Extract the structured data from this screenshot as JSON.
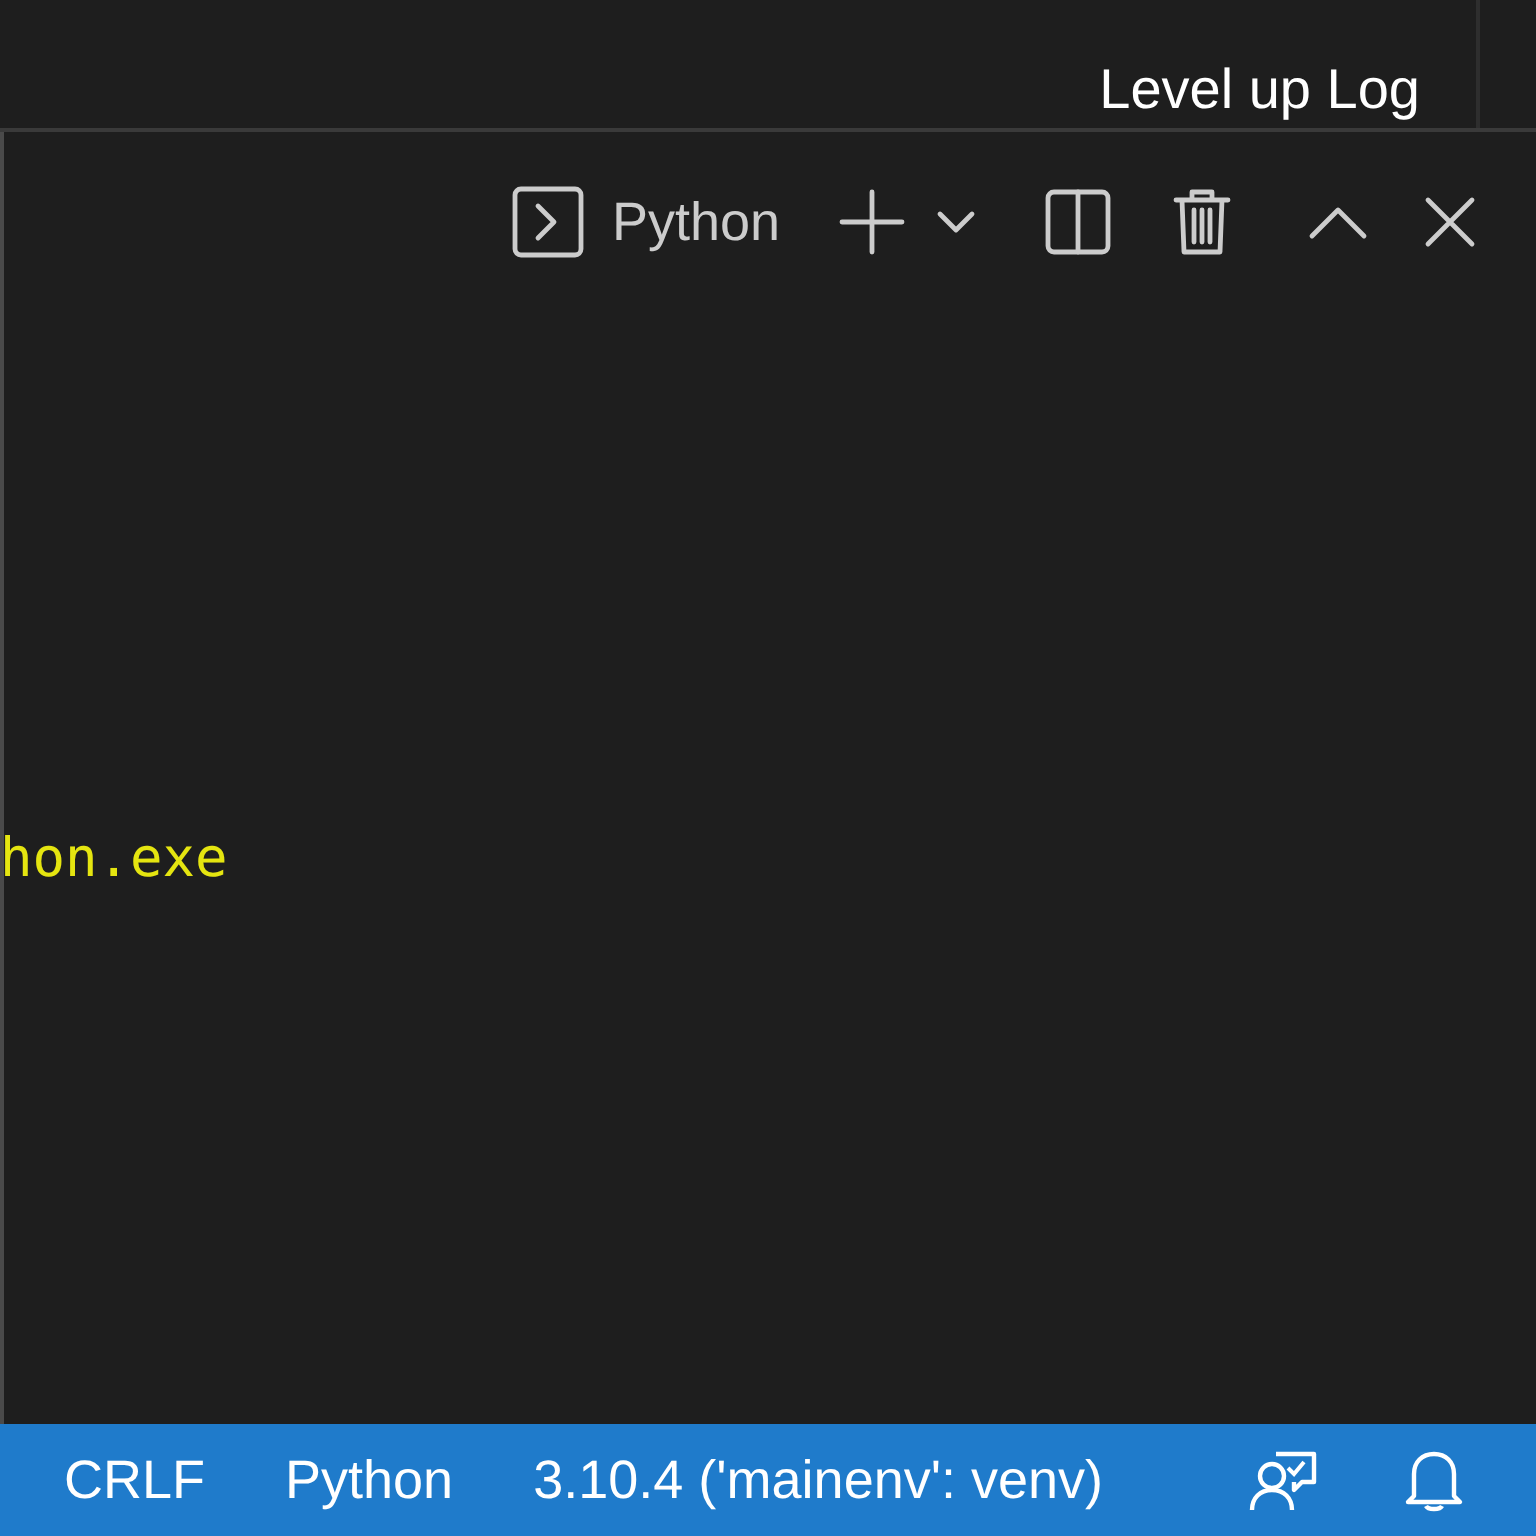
{
  "editor_tab": {
    "title": "Level up Log"
  },
  "terminal_toolbar": {
    "profile": "Python",
    "actions": [
      {
        "kind": "add"
      },
      {
        "kind": "dropdown"
      },
      {
        "kind": "split"
      },
      {
        "kind": "trash"
      },
      {
        "kind": "maximize"
      },
      {
        "kind": "close"
      }
    ]
  },
  "terminal": {
    "lines": [
      "hon.exe"
    ]
  },
  "status_bar": {
    "items": [
      "CRLF",
      "Python",
      "3.10.4 ('mainenv': venv)"
    ],
    "icons": [
      {
        "kind": "feedback"
      },
      {
        "kind": "bell"
      }
    ]
  }
}
